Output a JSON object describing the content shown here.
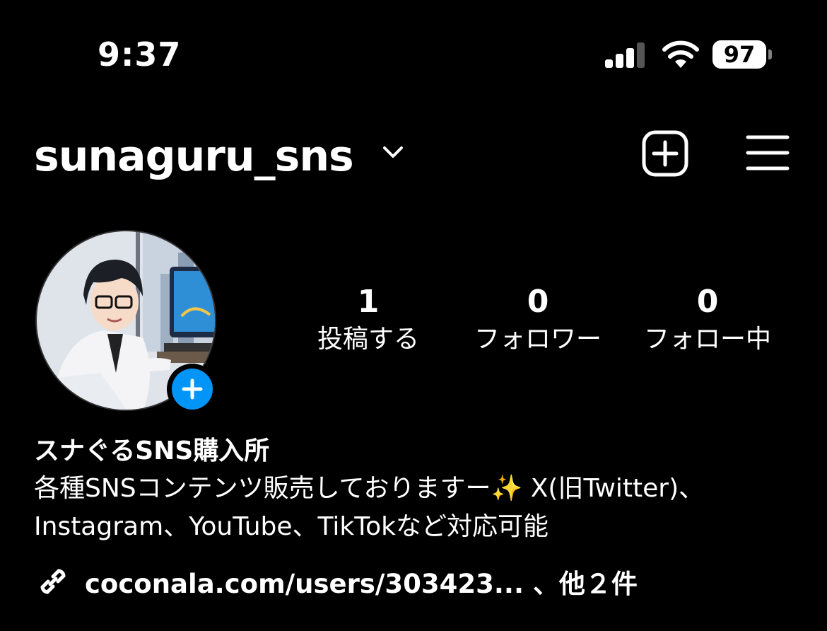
{
  "status_bar": {
    "time": "9:37",
    "battery": "97"
  },
  "header": {
    "username": "sunaguru_sns"
  },
  "stats": [
    {
      "value": "1",
      "label": "投稿する"
    },
    {
      "value": "0",
      "label": "フォロワー"
    },
    {
      "value": "0",
      "label": "フォロー中"
    }
  ],
  "profile": {
    "display_name": "スナぐるSNS購入所",
    "bio_line1": "各種SNSコンテンツ販売しておりますー✨ X(旧Twitter)、",
    "bio_line2": "Instagram、YouTube、TikTokなど対応可能",
    "link": "coconala.com/users/303423... 、他２件"
  },
  "colors": {
    "background": "#000000",
    "accent_blue": "#0095f6",
    "text": "#ffffff"
  }
}
